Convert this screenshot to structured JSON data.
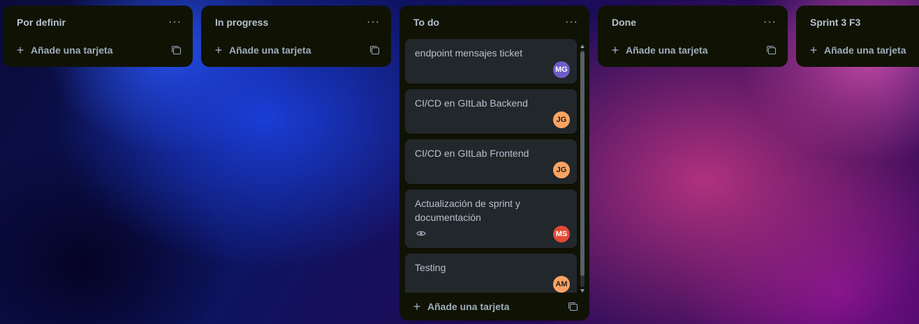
{
  "board": {
    "lists": [
      {
        "title": "Por definir",
        "menu": "···",
        "add_label": "Añade una tarjeta"
      },
      {
        "title": "In progress",
        "menu": "···",
        "add_label": "Añade una tarjeta"
      },
      {
        "title": "To do",
        "menu": "···",
        "add_label": "Añade una tarjeta",
        "cards": [
          {
            "title": "endpoint mensajes ticket",
            "member": "MG",
            "member_color": "#6e5dc6"
          },
          {
            "title": "CI/CD en GItLab Backend",
            "member": "JG",
            "member_color": "#fea362"
          },
          {
            "title": "CI/CD en GItLab Frontend",
            "member": "JG",
            "member_color": "#fea362"
          },
          {
            "title": "Actualización de sprint y documentación",
            "member": "MS",
            "member_color": "#e34935",
            "watching": true
          },
          {
            "title": "Testing",
            "member": "AM",
            "member_color": "#fea362"
          }
        ]
      },
      {
        "title": "Done",
        "menu": "···",
        "add_label": "Añade una tarjeta"
      },
      {
        "title": "Sprint 3 F3",
        "menu": "···",
        "add_label": "Añade una tarjeta"
      }
    ]
  },
  "icons": {
    "plus": "+",
    "menu": "more-horizontal-icon",
    "template": "card-template-icon",
    "watch": "eye-icon"
  }
}
